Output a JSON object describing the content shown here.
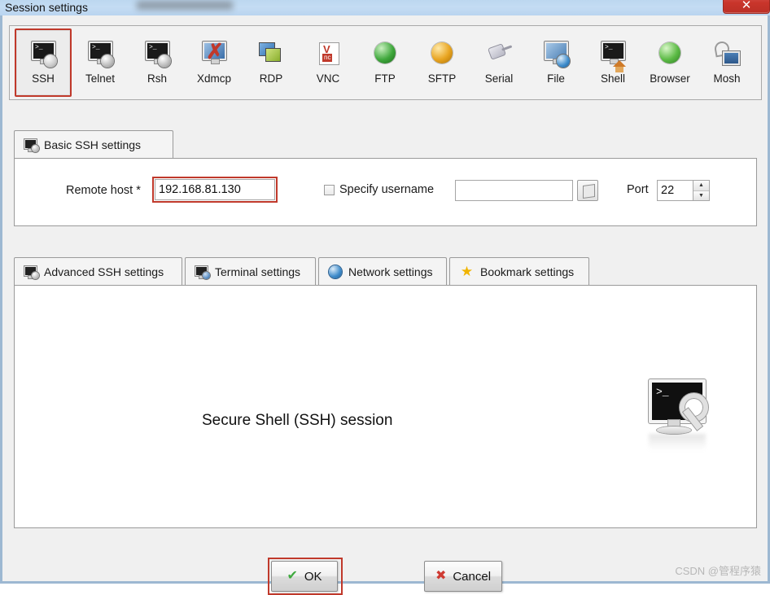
{
  "window": {
    "title": "Session settings",
    "close_label": "✕",
    "accent_red": "#c0392b",
    "titlebar_color": "#bcd7ef"
  },
  "toolbar": {
    "items": [
      {
        "label": "SSH",
        "icon": "ssh-monitor-key-icon",
        "selected": true
      },
      {
        "label": "Telnet",
        "icon": "telnet-monitor-icon",
        "selected": false
      },
      {
        "label": "Rsh",
        "icon": "rsh-monitor-icon",
        "selected": false
      },
      {
        "label": "Xdmcp",
        "icon": "xdmcp-icon",
        "selected": false
      },
      {
        "label": "RDP",
        "icon": "rdp-icon",
        "selected": false
      },
      {
        "label": "VNC",
        "icon": "vnc-icon",
        "selected": false
      },
      {
        "label": "FTP",
        "icon": "ftp-green-globe-icon",
        "selected": false
      },
      {
        "label": "SFTP",
        "icon": "sftp-orange-globe-icon",
        "selected": false
      },
      {
        "label": "Serial",
        "icon": "serial-plug-icon",
        "selected": false
      },
      {
        "label": "File",
        "icon": "file-share-icon",
        "selected": false
      },
      {
        "label": "Shell",
        "icon": "shell-home-icon",
        "selected": false
      },
      {
        "label": "Browser",
        "icon": "browser-globe-icon",
        "selected": false
      },
      {
        "label": "Mosh",
        "icon": "mosh-dish-icon",
        "selected": false
      }
    ]
  },
  "basic_settings": {
    "tab_label": "Basic SSH settings",
    "tab_icon": "monitor-icon",
    "remote_host_label": "Remote host *",
    "remote_host_value": "192.168.81.130",
    "remote_host_highlighted": true,
    "specify_username_label": "Specify username",
    "specify_username_checked": false,
    "username_value": "",
    "username_placeholder": "",
    "user_picker_icon": "user-card-icon",
    "port_label": "Port",
    "port_value": "22",
    "spinner_up_icon": "spinner-up-icon",
    "spinner_down_icon": "spinner-down-icon"
  },
  "advanced_tabs": [
    {
      "label": "Advanced SSH settings",
      "icon": "monitor-icon",
      "active": false
    },
    {
      "label": "Terminal settings",
      "icon": "terminal-icon",
      "active": false
    },
    {
      "label": "Network settings",
      "icon": "globe-icon",
      "active": false
    },
    {
      "label": "Bookmark settings",
      "icon": "star-icon",
      "active": false
    }
  ],
  "content": {
    "session_caption": "Secure Shell (SSH) session",
    "illustration_icon": "ssh-terminal-keys-illustration",
    "terminal_prompt": ">_"
  },
  "footer": {
    "ok_label": "OK",
    "ok_icon": "green-check-icon",
    "ok_highlighted": true,
    "cancel_label": "Cancel",
    "cancel_icon": "red-x-icon",
    "watermark": "CSDN @管程序猿"
  }
}
